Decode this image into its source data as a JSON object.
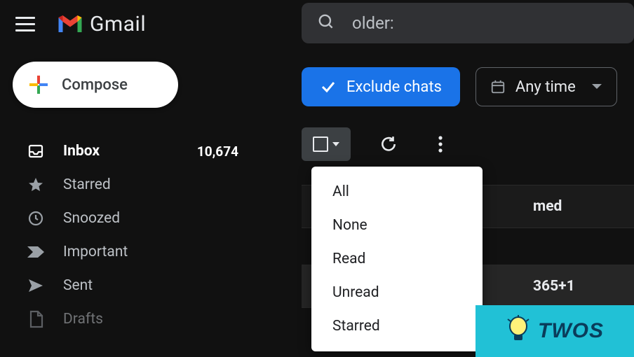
{
  "app": {
    "name": "Gmail"
  },
  "search": {
    "value": "older:"
  },
  "compose": {
    "label": "Compose"
  },
  "sidebar": {
    "items": [
      {
        "label": "Inbox",
        "count": "10,674",
        "active": true,
        "icon": "inbox-icon"
      },
      {
        "label": "Starred",
        "count": "",
        "active": false,
        "icon": "star-icon"
      },
      {
        "label": "Snoozed",
        "count": "",
        "active": false,
        "icon": "clock-icon"
      },
      {
        "label": "Important",
        "count": "",
        "active": false,
        "icon": "important-icon"
      },
      {
        "label": "Sent",
        "count": "",
        "active": false,
        "icon": "send-icon"
      },
      {
        "label": "Drafts",
        "count": "",
        "active": false,
        "icon": "draft-icon"
      }
    ]
  },
  "filters": {
    "exclude_chats": "Exclude chats",
    "time": "Any time"
  },
  "select_menu": {
    "items": [
      "All",
      "None",
      "Read",
      "Unread",
      "Starred"
    ]
  },
  "messages": {
    "row1_snippet": "med",
    "row2_snippet": "365+1"
  },
  "badge": {
    "text": "TWOS"
  },
  "colors": {
    "bg": "#111111",
    "accent": "#1a73e8",
    "badge": "#21c1d6"
  }
}
